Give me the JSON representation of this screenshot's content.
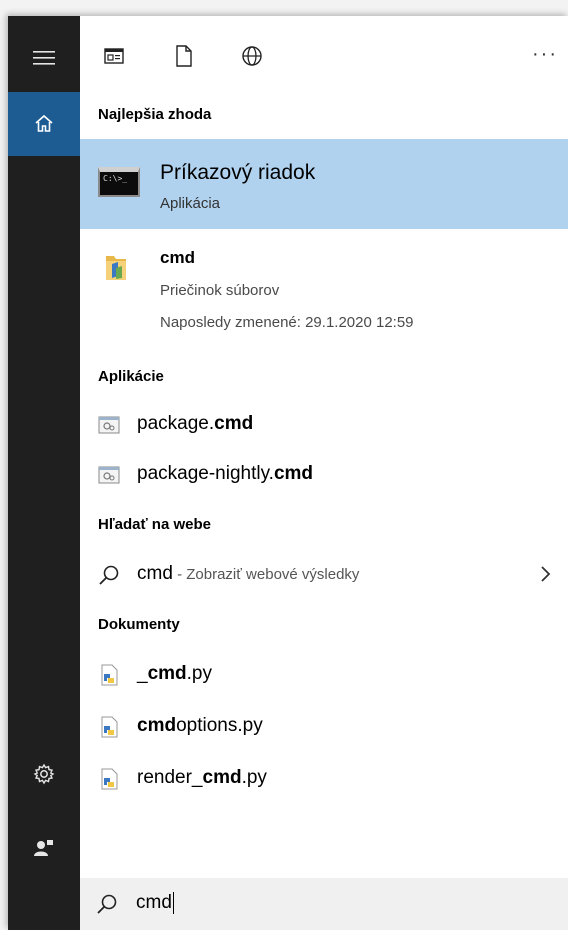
{
  "rail": {
    "items": [
      "menu-icon",
      "home-icon",
      "settings-icon",
      "account-icon"
    ],
    "accent": "#1c5c93"
  },
  "topbar": {
    "icons": [
      "news-icon",
      "document-icon",
      "globe-icon"
    ],
    "more": "···"
  },
  "best_match": {
    "header": "Najlepšia zhoda",
    "title": "Príkazový riadok",
    "subtitle": "Aplikácia",
    "icon_text": "C:\\>_",
    "highlight": "#b0d2ef"
  },
  "folder": {
    "title": "cmd",
    "type": "Priečinok súborov",
    "modified": "Naposledy zmenené: 29.1.2020 12:59"
  },
  "apps": {
    "header": "Aplikácie",
    "items": [
      {
        "prefix": "package.",
        "bold": "cmd",
        "suffix": ""
      },
      {
        "prefix": "package-nightly.",
        "bold": "cmd",
        "suffix": ""
      }
    ]
  },
  "web": {
    "header": "Hľadať na webe",
    "query": "cmd",
    "hint": " - Zobraziť webové výsledky"
  },
  "documents": {
    "header": "Dokumenty",
    "items": [
      {
        "prefix": "_",
        "bold": "cmd",
        "suffix": ".py"
      },
      {
        "prefix": "",
        "bold": "cmd",
        "suffix": "options.py"
      },
      {
        "prefix": "render_",
        "bold": "cmd",
        "suffix": ".py"
      }
    ]
  },
  "search": {
    "value": "cmd"
  }
}
